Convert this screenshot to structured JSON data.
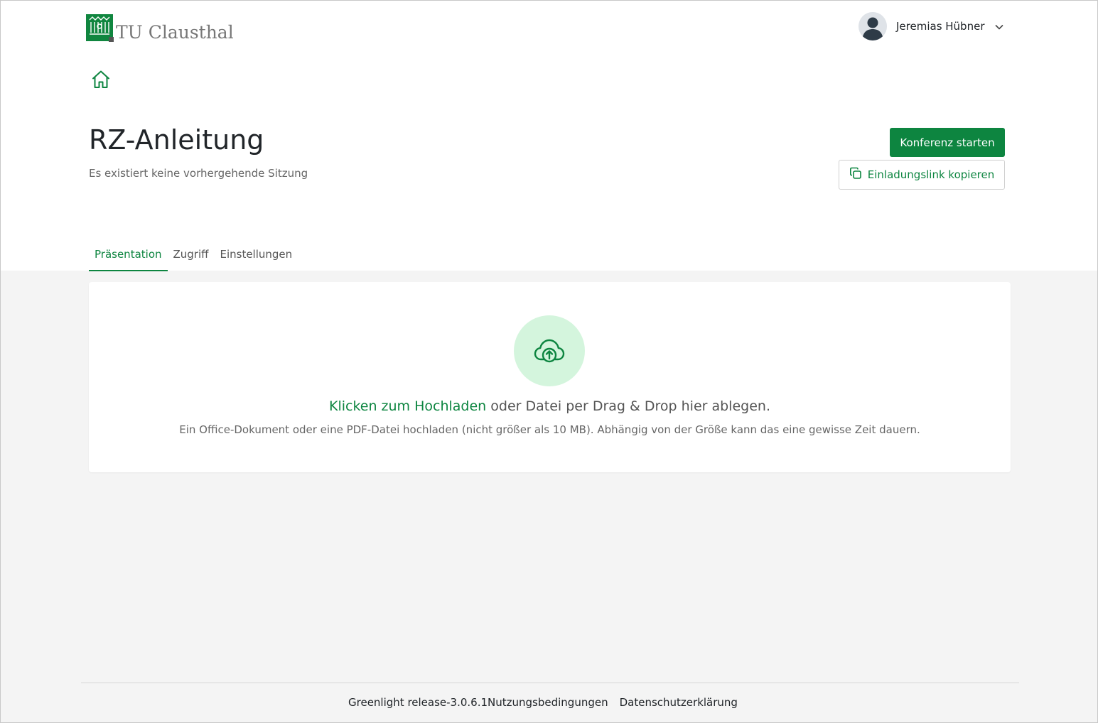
{
  "brand": {
    "logo_text": "TU Clausthal",
    "color_primary": "#0d8540",
    "color_upload_bg": "#d4f5dd"
  },
  "user_menu": {
    "name": "Jeremias Hübner",
    "avatar_icon": "user-avatar-icon",
    "chevron_icon": "chevron-down-icon"
  },
  "nav": {
    "home_icon": "home-icon"
  },
  "room": {
    "title": "RZ-Anleitung",
    "subtitle": "Es existiert keine vorhergehende Sitzung",
    "start_button_label": "Konferenz starten",
    "copy_button_label": "Einladungslink kopieren",
    "copy_icon": "copy-icon"
  },
  "tabs": [
    {
      "label": "Präsentation",
      "active": true
    },
    {
      "label": "Zugriff",
      "active": false
    },
    {
      "label": "Einstellungen",
      "active": false
    }
  ],
  "upload": {
    "icon": "cloud-upload-icon",
    "link_text": "Klicken zum Hochladen",
    "rest_text": " oder Datei per Drag & Drop hier ablegen.",
    "hint": "Ein Office-Dokument oder eine PDF-Datei hochladen (nicht größer als 10 MB). Abhängig von der Größe kann das eine gewisse Zeit dauern."
  },
  "footer": {
    "product": "Greenlight",
    "version": " release-3.0.6.1",
    "terms": "Nutzungsbedingungen",
    "privacy": "Datenschutzerklärung"
  }
}
